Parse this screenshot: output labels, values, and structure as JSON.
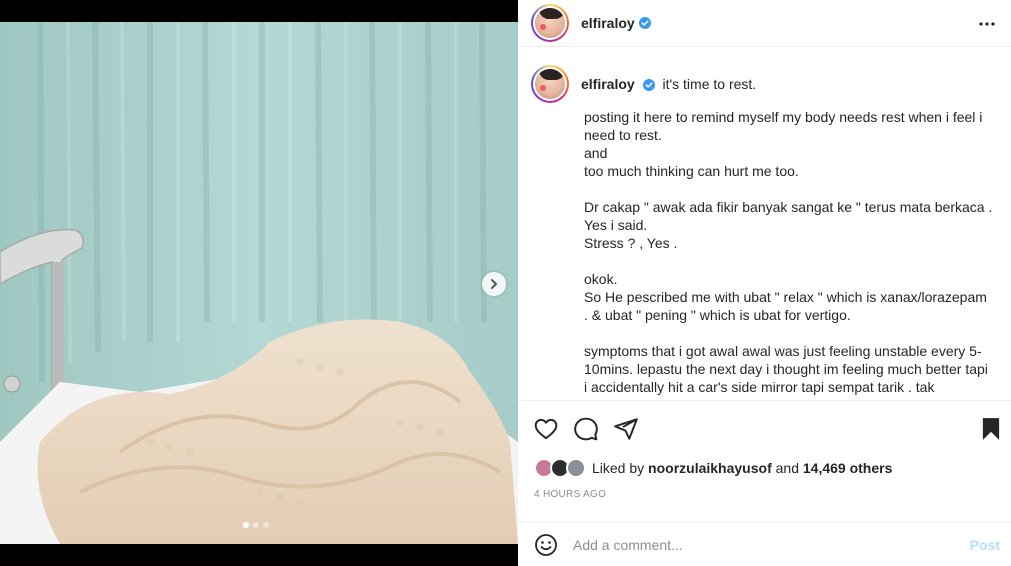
{
  "post": {
    "username": "elfiraloy",
    "caption_first_line": "it's time to rest.",
    "caption_paragraphs": [
      [
        "posting it here to remind myself my body needs rest when i feel i need to rest.",
        "and",
        "too much thinking can hurt me too."
      ],
      [
        "Dr cakap \" awak ada fikir banyak sangat ke \" terus mata berkaca . Yes i said.",
        "Stress ? , Yes ."
      ],
      [
        "okok.",
        "So He pescribed me with ubat \" relax \" which is xanax/lorazepam . & ubat \" pening \" which is ubat for vertigo."
      ],
      [
        "symptoms that i got awal awal was just feeling unstable every 5-10mins. lepastu the next day i thought im feeling much better tapi i accidentally hit a car's side mirror tapi sempat tarik . tak"
      ]
    ],
    "likes": {
      "prefix": "Liked by",
      "user": "noorzulaikhayusof",
      "connector": "and",
      "count": "14,469 others"
    },
    "timestamp": "4 HOURS AGO",
    "carousel": {
      "total": 3,
      "active_index": 0
    }
  },
  "comment": {
    "placeholder": "Add a comment...",
    "post_label": "Post"
  },
  "icons": {
    "verified": "verified-badge-icon",
    "more": "more-options-icon",
    "like": "heart-icon",
    "comment": "comment-icon",
    "share": "share-icon",
    "save": "bookmark-icon",
    "emoji": "emoji-icon",
    "next": "chevron-right-icon"
  },
  "colors": {
    "verified_blue": "#3897f0",
    "post_button_disabled": "#b2dffc",
    "secondary_text": "#8e8e8e"
  }
}
